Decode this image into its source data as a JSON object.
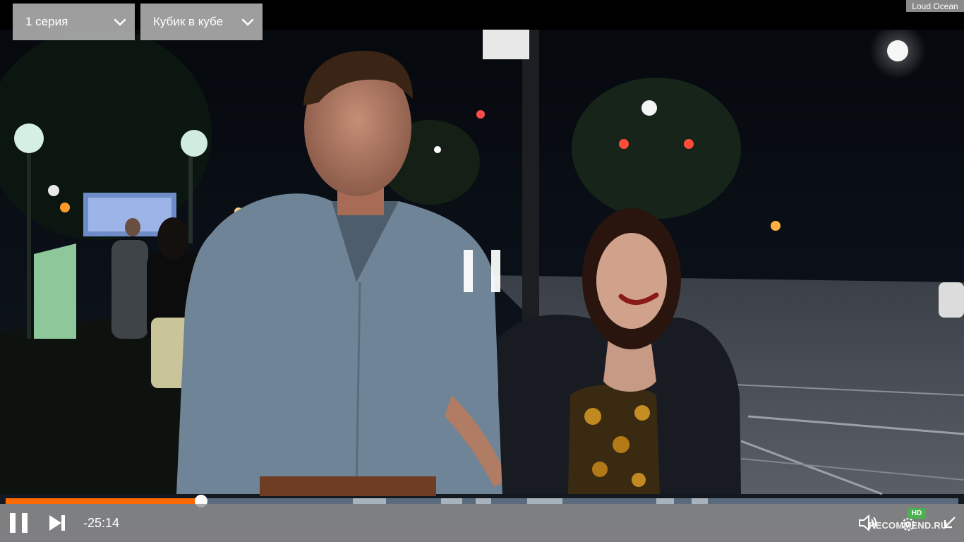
{
  "player": {
    "episode_select": {
      "value": "1 серия"
    },
    "studio_select": {
      "value": "Кубик в кубе"
    },
    "corner_label": "Loud Ocean",
    "time_remaining": "-25:14",
    "quality_badge": "HD",
    "watermark": "RECOMMEND.RU",
    "progress": 0.205,
    "state": "paused",
    "accent_color": "#ff6a00"
  },
  "icons": {
    "select_arrow": "chevron-down-icon",
    "center": "pause-icon",
    "play_pause": "pause-icon",
    "next": "next-episode-icon",
    "volume": "volume-icon",
    "settings": "gear-icon",
    "fullscreen": "exit-fullscreen-icon"
  }
}
